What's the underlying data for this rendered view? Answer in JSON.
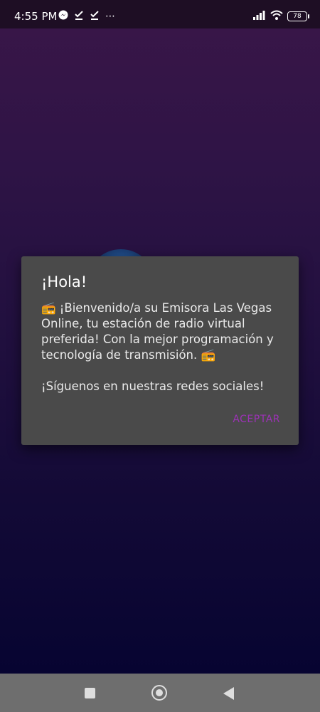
{
  "status_bar": {
    "time": "4:55 PM",
    "left_icons": [
      "messenger-icon",
      "download-done-icon",
      "download-done-icon",
      "more-icon"
    ],
    "battery_level": "78"
  },
  "dialog": {
    "title": "¡Hola!",
    "message": "📻 ¡Bienvenido/a su Emisora Las Vegas Online, tu estación de radio virtual preferida! Con la mejor programación y tecnología de transmisión. 📻\n\n¡Síguenos en nuestras redes sociales!",
    "accept_label": "ACEPTAR"
  },
  "colors": {
    "accent": "#9c32b6",
    "dialog_bg": "#4a4a4a",
    "nav_bg": "#6e6e6e"
  }
}
